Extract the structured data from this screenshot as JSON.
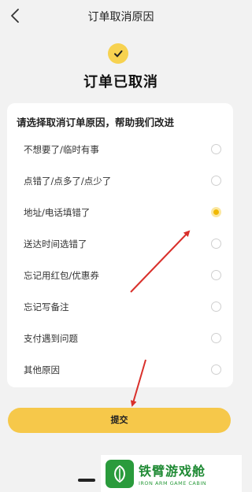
{
  "header": {
    "title": "订单取消原因"
  },
  "status": {
    "title": "订单已取消"
  },
  "form": {
    "heading": "请选择取消订单原因，帮助我们改进",
    "options": [
      {
        "label": "不想要了/临时有事",
        "selected": false
      },
      {
        "label": "点错了/点多了/点少了",
        "selected": false
      },
      {
        "label": "地址/电话填错了",
        "selected": true
      },
      {
        "label": "送达时间选错了",
        "selected": false
      },
      {
        "label": "忘记用红包/优惠券",
        "selected": false
      },
      {
        "label": "忘记写备注",
        "selected": false
      },
      {
        "label": "支付遇到问题",
        "selected": false
      },
      {
        "label": "其他原因",
        "selected": false
      }
    ]
  },
  "actions": {
    "submit_label": "提交"
  },
  "watermark": {
    "name": "铁臂游戏舱",
    "subtitle": "IRON ARM GAME CABIN"
  },
  "colors": {
    "accent": "#f6c84a",
    "selected_radio": "#f0b800",
    "annotation_arrow": "#d9302b",
    "watermark_green": "#2a9b3c"
  },
  "icons": {
    "back": "chevron-left-icon",
    "status": "check-circle-icon",
    "watermark": "leaf-logo-icon"
  }
}
